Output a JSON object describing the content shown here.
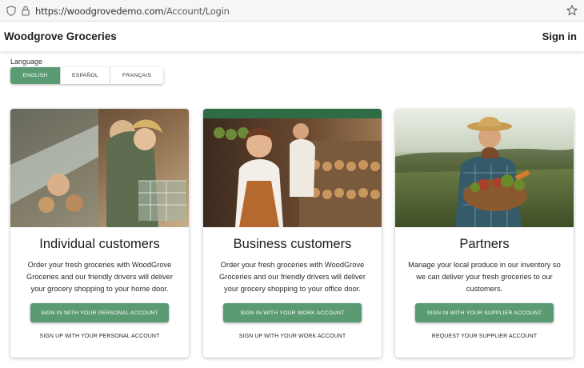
{
  "browser": {
    "url_host": "https://woodgrovedemo.com",
    "url_path": "/Account/Login"
  },
  "header": {
    "brand": "Woodgrove Groceries",
    "sign_in": "Sign in"
  },
  "language": {
    "label": "Language",
    "options": [
      "ENGLISH",
      "ESPAÑOL",
      "FRANÇAIS"
    ],
    "selected": "ENGLISH"
  },
  "cards": [
    {
      "title": "Individual customers",
      "description": "Order your fresh groceries with WoodGrove Groceries and our friendly drivers will deliver your grocery shopping to your home door.",
      "primary": "SIGN IN WITH YOUR PERSONAL ACCOUNT",
      "secondary": "SIGN UP WITH YOUR PERSONAL ACCOUNT"
    },
    {
      "title": "Business customers",
      "description": "Order your fresh groceries with WoodGrove Groceries and our friendly drivers will deliver your grocery shopping to your office door.",
      "primary": "SIGN IN WITH YOUR WORK ACCOUNT",
      "secondary": "SIGN UP WITH YOUR WORK ACCOUNT"
    },
    {
      "title": "Partners",
      "description": "Manage your local produce in our inventory so we can deliver your fresh groceries to our customers.",
      "primary": "SIGN IN WITH YOUR SUPPLIER ACCOUNT",
      "secondary": "REQUEST YOUR SUPPLIER ACCOUNT"
    }
  ],
  "colors": {
    "accent": "#5b9b74"
  }
}
